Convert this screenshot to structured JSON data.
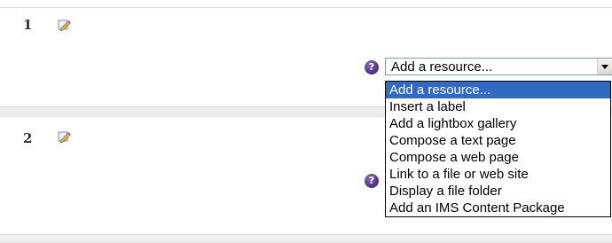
{
  "sections": [
    {
      "number": "1",
      "edit_icon": "edit-pencil-icon",
      "help_icon": "help-icon",
      "help_glyph": "?"
    },
    {
      "number": "2",
      "edit_icon": "edit-pencil-icon",
      "help_icon": "help-icon",
      "help_glyph": "?"
    }
  ],
  "resource_select": {
    "selected": "Add a resource...",
    "options": [
      "Add a resource...",
      "Insert a label",
      "Add a lightbox gallery",
      "Compose a text page",
      "Compose a web page",
      "Link to a file or web site",
      "Display a file folder",
      "Add an IMS Content Package"
    ],
    "highlight_color": "#316ac5"
  },
  "colors": {
    "help_icon": "#5b3a8a",
    "edit_icon": "#4a7fc1",
    "section_band": "#ececec"
  }
}
